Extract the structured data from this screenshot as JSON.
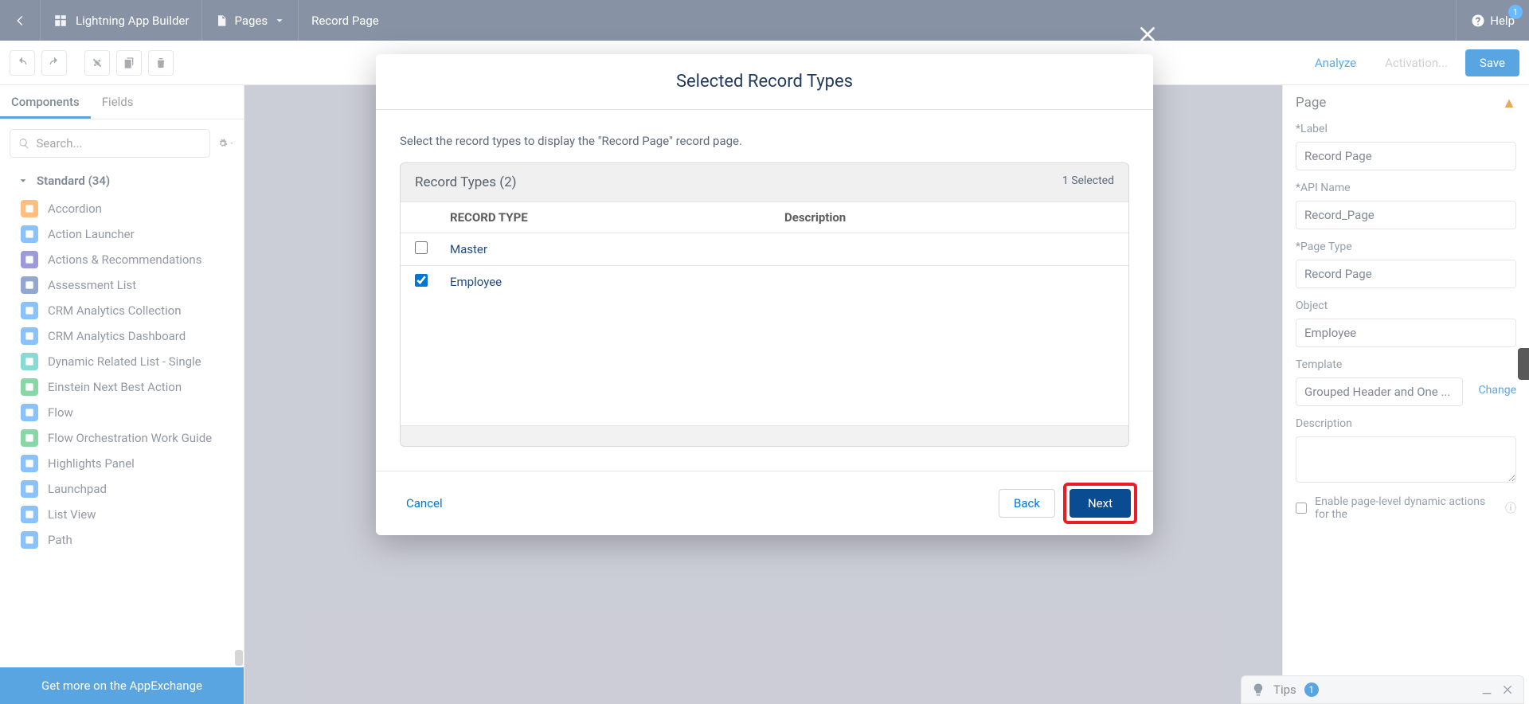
{
  "topbar": {
    "app_name": "Lightning App Builder",
    "pages_label": "Pages",
    "page_title": "Record Page",
    "help_label": "Help",
    "help_badge": "1"
  },
  "toolbar": {
    "analyze": "Analyze",
    "activation": "Activation...",
    "save": "Save"
  },
  "left": {
    "tab_components": "Components",
    "tab_fields": "Fields",
    "search_placeholder": "Search...",
    "section_title": "Standard (34)",
    "items": [
      {
        "label": "Accordion",
        "color": "c-orange"
      },
      {
        "label": "Action Launcher",
        "color": "c-blue"
      },
      {
        "label": "Actions & Recommendations",
        "color": "c-purple"
      },
      {
        "label": "Assessment List",
        "color": "c-navy"
      },
      {
        "label": "CRM Analytics Collection",
        "color": "c-blue"
      },
      {
        "label": "CRM Analytics Dashboard",
        "color": "c-blue"
      },
      {
        "label": "Dynamic Related List - Single",
        "color": "c-teal"
      },
      {
        "label": "Einstein Next Best Action",
        "color": "c-tealgreen"
      },
      {
        "label": "Flow",
        "color": "c-blue"
      },
      {
        "label": "Flow Orchestration Work Guide",
        "color": "c-tealgreen"
      },
      {
        "label": "Highlights Panel",
        "color": "c-blue"
      },
      {
        "label": "Launchpad",
        "color": "c-blue"
      },
      {
        "label": "List View",
        "color": "c-blue"
      },
      {
        "label": "Path",
        "color": "c-blue"
      }
    ],
    "appexchange": "Get more on the AppExchange"
  },
  "right": {
    "title": "Page",
    "label_label": "*Label",
    "label_value": "Record Page",
    "apiname_label": "*API Name",
    "apiname_value": "Record_Page",
    "pagetype_label": "*Page Type",
    "pagetype_value": "Record Page",
    "object_label": "Object",
    "object_value": "Employee",
    "template_label": "Template",
    "template_value": "Grouped Header and One ...",
    "change": "Change",
    "description_label": "Description",
    "enable_dynamic": "Enable page-level dynamic actions for the"
  },
  "tips": {
    "label": "Tips",
    "count": "1"
  },
  "modal": {
    "title": "Selected Record Types",
    "instruction": "Select the record types to display the \"Record Page\" record page.",
    "table_title": "Record Types (2)",
    "selected_text": "1 Selected",
    "col_record_type": "RECORD TYPE",
    "col_description": "Description",
    "rows": [
      {
        "name": "Master",
        "checked": false
      },
      {
        "name": "Employee",
        "checked": true
      }
    ],
    "cancel": "Cancel",
    "back": "Back",
    "next": "Next"
  }
}
